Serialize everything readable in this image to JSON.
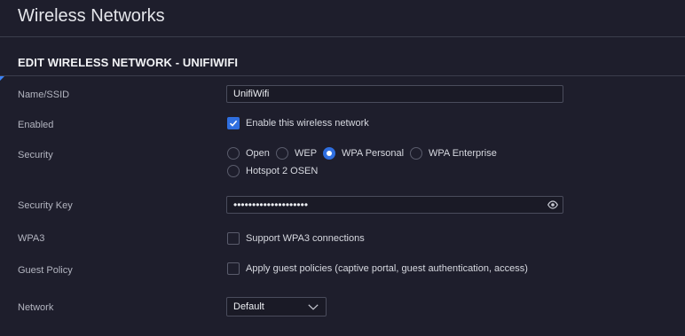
{
  "page": {
    "title": "Wireless Networks"
  },
  "section": {
    "title": "EDIT WIRELESS NETWORK - UNIFIWIFI"
  },
  "fields": {
    "ssid": {
      "label": "Name/SSID",
      "value": "UnifiWifi"
    },
    "enabled": {
      "label": "Enabled",
      "checkbox_label": "Enable this wireless network",
      "checked": true
    },
    "security": {
      "label": "Security",
      "options": [
        "Open",
        "WEP",
        "WPA Personal",
        "WPA Enterprise",
        "Hotspot 2 OSEN"
      ],
      "selected": "WPA Personal"
    },
    "security_key": {
      "label": "Security Key",
      "masked_value": "••••••••••••••••••••"
    },
    "wpa3": {
      "label": "WPA3",
      "checkbox_label": "Support WPA3 connections",
      "checked": false
    },
    "guest_policy": {
      "label": "Guest Policy",
      "checkbox_label": "Apply guest policies (captive portal, guest authentication, access)",
      "checked": false
    },
    "network": {
      "label": "Network",
      "value": "Default"
    }
  },
  "icons": {
    "check": "check-icon",
    "eye": "eye-icon",
    "chevron": "chevron-down-icon"
  },
  "colors": {
    "background": "#1e1e2c",
    "accent": "#2f6fe0",
    "divider": "#3b3d4c"
  }
}
